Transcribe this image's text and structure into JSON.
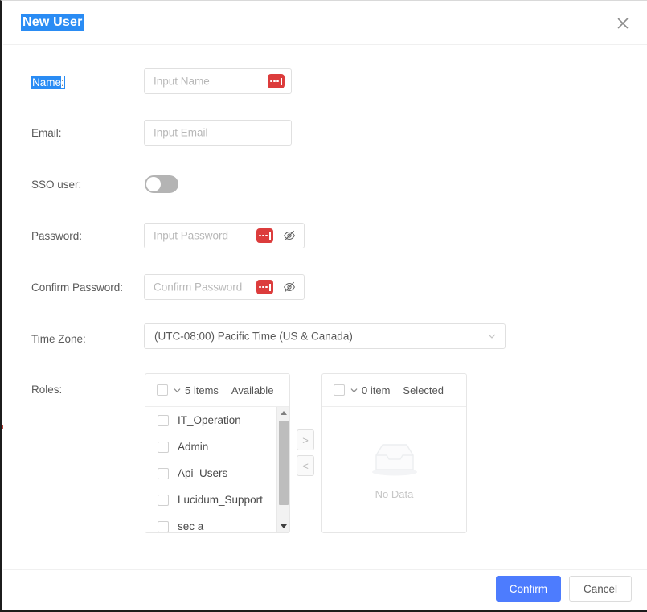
{
  "dialog": {
    "title": "New User",
    "close_icon": "close-icon"
  },
  "form": {
    "name": {
      "label": "Name",
      "label_suffix": ":",
      "placeholder": "Input Name",
      "value": "",
      "autofill_icon": "password-autofill-icon"
    },
    "email": {
      "label": "Email:",
      "placeholder": "Input Email",
      "value": ""
    },
    "sso_user": {
      "label": "SSO user:",
      "state": "off"
    },
    "password": {
      "label": "Password:",
      "placeholder": "Input Password",
      "value": "",
      "autofill_icon": "password-autofill-icon",
      "reveal_icon": "eye-slash-icon"
    },
    "confirm_password": {
      "label": "Confirm Password:",
      "placeholder": "Confirm Password",
      "value": "",
      "autofill_icon": "password-autofill-icon",
      "reveal_icon": "eye-slash-icon"
    },
    "time_zone": {
      "label": "Time Zone:",
      "value": "(UTC-08:00) Pacific Time (US & Canada)",
      "chevron_icon": "chevron-down-icon"
    },
    "roles": {
      "label": "Roles:",
      "available": {
        "count_text": "5 items",
        "title": "Available",
        "checked": false,
        "items": [
          {
            "label": "IT_Operation",
            "checked": false
          },
          {
            "label": "Admin",
            "checked": false
          },
          {
            "label": "Api_Users",
            "checked": false
          },
          {
            "label": "Lucidum_Support",
            "checked": false
          },
          {
            "label": "sec a",
            "checked": false
          }
        ]
      },
      "selected": {
        "count_text": "0 item",
        "title": "Selected",
        "checked": false,
        "empty_text": "No Data",
        "empty_icon": "inbox-empty-icon"
      },
      "move_right_label": ">",
      "move_left_label": "<"
    }
  },
  "footer": {
    "confirm_label": "Confirm",
    "cancel_label": "Cancel"
  },
  "colors": {
    "primary": "#4d7cfe",
    "selection": "#2a8cf4",
    "autofill_badge": "#dc3c3c"
  }
}
